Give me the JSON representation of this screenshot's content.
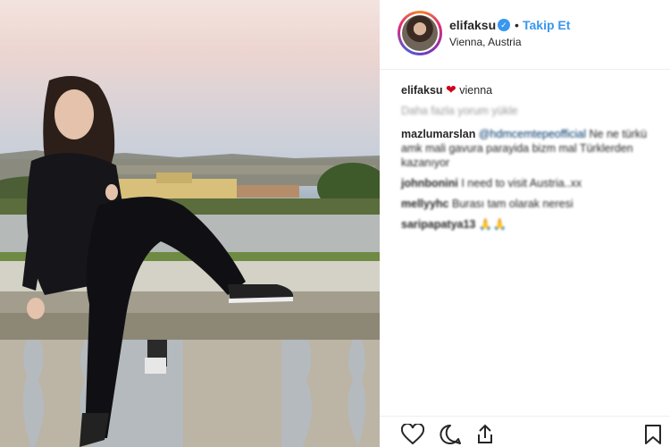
{
  "photo": {
    "description_icon": "photo-woman-on-balustrade"
  },
  "header": {
    "username": "elifaksu",
    "verified_icon": "verified-check-icon",
    "separator": "•",
    "follow_label": "Takip Et",
    "location": "Vienna, Austria"
  },
  "caption": {
    "user": "elifaksu",
    "emoji": "❤",
    "text": "vienna"
  },
  "load_more": "Daha fazla yorum yükle",
  "comments": [
    {
      "user": "mazlumarslan",
      "mention": "@hdmcemtepeofficial",
      "text": "Ne ne türkü amk mali gavura parayida bizm mal Türklerden kazanıyor"
    },
    {
      "user": "johnbonini",
      "text": "I need to visit Austria..xx"
    },
    {
      "user": "mellyyhc",
      "text": "Burası tam olarak neresi"
    },
    {
      "user": "saripapatya13",
      "text": "🙏🙏"
    }
  ],
  "actions": {
    "like_icon": "heart-icon",
    "comment_icon": "comment-icon",
    "share_icon": "share-icon",
    "save_icon": "bookmark-icon"
  },
  "colors": {
    "accent": "#3897f0",
    "text": "#262626",
    "heart": "#d0021b"
  }
}
